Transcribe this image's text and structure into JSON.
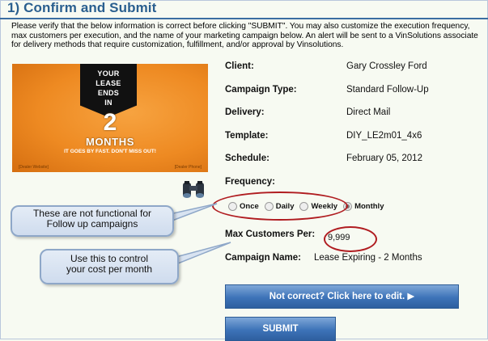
{
  "header": {
    "title": "1) Confirm and Submit"
  },
  "intro": "Please verify that the below information is correct before clicking \"SUBMIT\". You may also customize the execution frequency, max customers per execution, and the name of your marketing campaign below. An alert will be sent to a VinSolutions associate for delivery methods that require customization, fulfillment, and/or approval by Vinsolutions.",
  "promo": {
    "line1": "YOUR",
    "line2": "LEASE",
    "line3": "ENDS",
    "line4": "IN",
    "number": "2",
    "unit": "MONTHS",
    "tagline": "IT GOES BY FAST. DON'T MISS OUT!",
    "foot_left": "[Dealer Website]",
    "foot_right": "[Dealer Phone]"
  },
  "details": {
    "client_label": "Client:",
    "client_value": "Gary Crossley Ford",
    "type_label": "Campaign Type:",
    "type_value": "Standard Follow-Up",
    "delivery_label": "Delivery:",
    "delivery_value": "Direct Mail",
    "template_label": "Template:",
    "template_value": "DIY_LE2m01_4x6",
    "schedule_label": "Schedule:",
    "schedule_value": "February 05, 2012",
    "frequency_label": "Frequency:",
    "max_label": "Max Customers Per:",
    "max_value": "9,999",
    "name_label": "Campaign Name:",
    "name_value": "Lease Expiring - 2 Months"
  },
  "frequency_options": [
    {
      "label": "Once",
      "checked": false
    },
    {
      "label": "Daily",
      "checked": false
    },
    {
      "label": "Weekly",
      "checked": false
    },
    {
      "label": "Monthly",
      "checked": true
    }
  ],
  "callouts": {
    "c1_line1": "These are not functional for",
    "c1_line2": "Follow up campaigns",
    "c2_line1": "Use this to control",
    "c2_line2": "your cost per month"
  },
  "buttons": {
    "edit": "Not correct? Click here to edit.  ▶",
    "submit": "SUBMIT"
  },
  "colors": {
    "accent": "#2a5f8f",
    "highlight": "#b01c20",
    "button": "#3d73b8",
    "promo": "#ee8a22"
  },
  "icons": {
    "binoculars": "binoculars-icon"
  }
}
